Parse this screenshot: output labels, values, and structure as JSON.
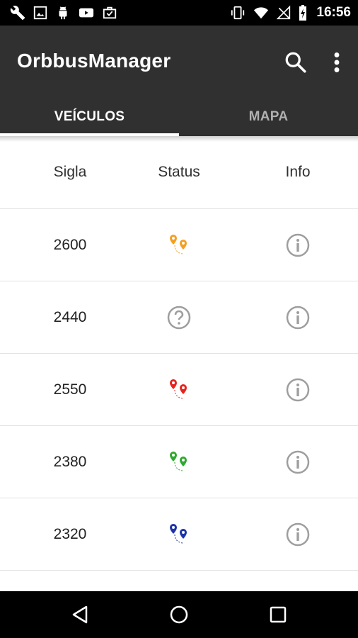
{
  "status_bar": {
    "time": "16:56",
    "left_icons": [
      "wrench-icon",
      "image-icon",
      "android-icon",
      "youtube-icon",
      "briefcase-icon"
    ],
    "right_icons": [
      "vibrate-icon",
      "wifi-icon",
      "no-signal-icon",
      "battery-charging-icon"
    ]
  },
  "app_bar": {
    "title": "OrbbusManager",
    "actions": [
      "search-icon",
      "more-vert-icon"
    ]
  },
  "tabs": [
    {
      "label": "VEÍCULOS",
      "active": true
    },
    {
      "label": "MAPA",
      "active": false
    }
  ],
  "table": {
    "headers": {
      "sigla": "Sigla",
      "status": "Status",
      "info": "Info"
    },
    "rows": [
      {
        "sigla": "2600",
        "status_icon": "route-pins-icon",
        "status_color": "#f5a020"
      },
      {
        "sigla": "2440",
        "status_icon": "help-circle-icon",
        "status_color": "#9e9e9e"
      },
      {
        "sigla": "2550",
        "status_icon": "route-pins-icon",
        "status_color": "#e8231d"
      },
      {
        "sigla": "2380",
        "status_icon": "route-pins-icon",
        "status_color": "#2eaa2e"
      },
      {
        "sigla": "2320",
        "status_icon": "route-pins-icon",
        "status_color": "#1e35a8"
      }
    ],
    "info_icon": "info-circle-icon"
  },
  "nav_bar": {
    "buttons": [
      "back-triangle-icon",
      "home-circle-icon",
      "recents-square-icon"
    ]
  },
  "colors": {
    "app_bar": "#303030",
    "status_bar": "#000000",
    "tab_active": "#ffffff",
    "tab_inactive": "#b0b0b0"
  }
}
